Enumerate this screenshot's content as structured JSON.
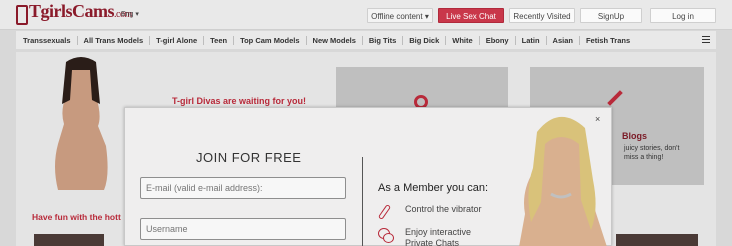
{
  "header": {
    "logo_text": "TgirlsCams",
    "logo_suffix": ".com",
    "language": "Eng ▾",
    "offline_dropdown": "Offline content ▾",
    "live_sex_chat": "Live Sex Chat",
    "recently_visited": "Recently Visited",
    "signup": "SignUp",
    "login": "Log in"
  },
  "categories": [
    "Transsexuals",
    "All Trans Models",
    "T-girl Alone",
    "Teen",
    "Top Cam Models",
    "New Models",
    "Big Tits",
    "Big Dick",
    "White",
    "Ebony",
    "Latin",
    "Asian",
    "Fetish Trans"
  ],
  "background": {
    "promo": "T-girl Divas are waiting for you!",
    "blogs_title": "Blogs",
    "blogs_text": "juicy stories, don't miss a thing!",
    "have_fun": "Have fun with the hott"
  },
  "modal": {
    "close": "×",
    "title": "JOIN FOR FREE",
    "email_placeholder": "E-mail (valid e-mail address):",
    "username_placeholder": "Username",
    "member_heading": "As a Member you can:",
    "benefits": [
      "Control the vibrator",
      "Enjoy interactive\nPrivate Chats"
    ]
  },
  "colors": {
    "accent": "#c9374a",
    "brand": "#8a1a2a"
  }
}
